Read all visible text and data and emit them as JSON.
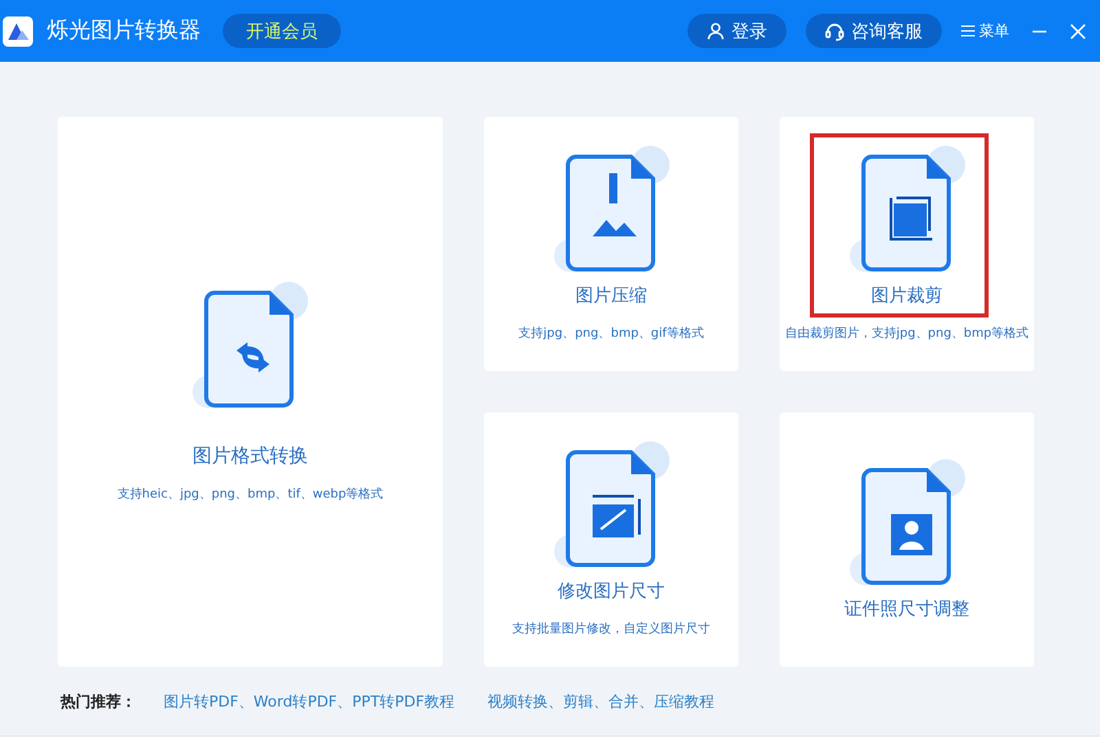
{
  "header": {
    "app_name": "烁光图片转换器",
    "vip_button": "开通会员",
    "login_button": "登录",
    "service_button": "咨询客服",
    "menu_button": "菜单"
  },
  "tools": [
    {
      "kind": "convert",
      "title": "图片格式转换",
      "subtitle": "支持heic、jpg、png、bmp、tif、webp等格式",
      "highlighted": false
    },
    {
      "kind": "compress",
      "title": "图片压缩",
      "subtitle": "支持jpg、png、bmp、gif等格式",
      "highlighted": false
    },
    {
      "kind": "crop",
      "title": "图片裁剪",
      "subtitle": "自由裁剪图片，支持jpg、png、bmp等格式",
      "highlighted": true
    },
    {
      "kind": "resize",
      "title": "修改图片尺寸",
      "subtitle": "支持批量图片修改，自定义图片尺寸",
      "highlighted": false
    },
    {
      "kind": "idphoto",
      "title": "证件照尺寸调整",
      "highlighted": false
    }
  ],
  "hot": {
    "label": "热门推荐：",
    "links": [
      "图片转PDF、Word转PDF、PPT转PDF教程",
      "视频转换、剪辑、合并、压缩教程"
    ]
  }
}
